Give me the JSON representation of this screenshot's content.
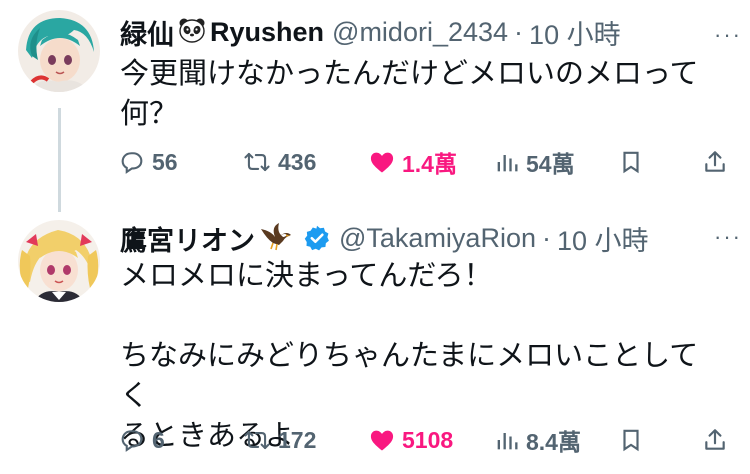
{
  "tweets": [
    {
      "display_name": "緑仙",
      "name_suffix": "Ryushen",
      "emoji": "panda-face",
      "handle": "@midori_2434",
      "separator": "·",
      "time": "10 小時",
      "more": "···",
      "text": "今更聞けなかったんだけどメロいのメロって\n何？",
      "replies": "56",
      "retweets": "436",
      "likes": "1.4萬",
      "views": "54萬",
      "liked": true
    },
    {
      "display_name": "鷹宮リオン",
      "emoji": "eagle",
      "verified": true,
      "handle": "@TakamiyaRion",
      "separator": "·",
      "time": "10 小時",
      "more": "···",
      "text": "メロメロに決まってんだろ！\n\nちなみにみどりちゃんたまにメロいことしてく\nるときあるよ",
      "replies": "6",
      "retweets": "172",
      "likes": "5108",
      "views": "8.4萬",
      "liked": true
    }
  ],
  "colors": {
    "text": "#0f1419",
    "muted": "#536471",
    "like": "#f91880",
    "verified": "#1d9bf0",
    "thread_line": "#cfd9de"
  }
}
